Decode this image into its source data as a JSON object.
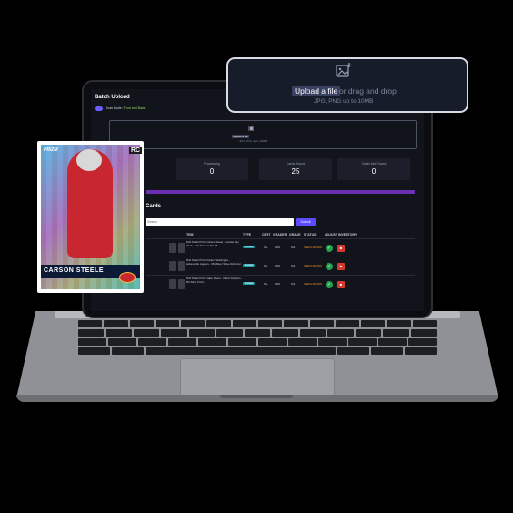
{
  "batch": {
    "title": "Batch Upload",
    "scan_mode_label": "Scan Mode:",
    "scan_mode_value": "Front and Back"
  },
  "upload": {
    "link_text": "Upload a file",
    "rest_text": "or drag and drop",
    "hint": "JPG, PNG up to 10MB"
  },
  "stats": [
    {
      "label": "Processing",
      "value": "0"
    },
    {
      "label": "Cards Found",
      "value": "25"
    },
    {
      "label": "Cards Not Found",
      "value": "0"
    }
  ],
  "cards_section": {
    "title": "Cards",
    "search_placeholder": "Search",
    "submit_label": "Submit"
  },
  "table": {
    "headers": [
      "ITEM",
      "TYPE",
      "CERT",
      "GRADER",
      "GRADE",
      "STATUS",
      "ADJUST INVENTORY"
    ],
    "rows": [
      {
        "item": "2024 Panini Prizm Carson Steele - Kansas City Chiefs - 371 Pandora RC #8",
        "type": "Football",
        "cert": "N/A",
        "grader": "RAW",
        "grade": "N/A",
        "status": "NEEDS REVIEW"
      },
      {
        "item": "2024 Panini Prizm Parker Washington - Jacksonville Jaguars - 361 Silver Wave Refractor",
        "type": "Football",
        "cert": "N/A",
        "grader": "RAW",
        "grade": "N/A",
        "status": "NEEDS REVIEW"
      },
      {
        "item": "2024 Panini Prizm Jalen Rivers - Miami Dolphins - 356 Silver Prizm",
        "type": "Football",
        "cert": "N/A",
        "grader": "RAW",
        "grade": "N/A",
        "status": "NEEDS REVIEW"
      }
    ]
  },
  "card_overlay": {
    "brand": "PRIZM",
    "rc": "RC",
    "player_name": "CARSON STEELE"
  },
  "colors": {
    "accent": "#5b4cff",
    "progress": "#6b2fb3",
    "ok": "#23a24a",
    "delete": "#d33a2f"
  }
}
